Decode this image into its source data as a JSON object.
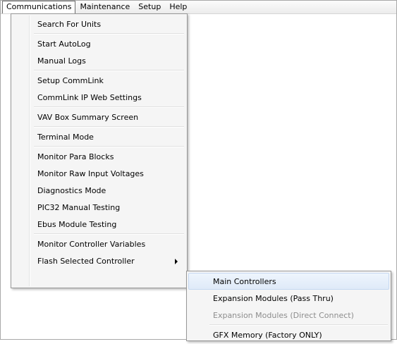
{
  "menubar": {
    "items": [
      {
        "label": "Communications"
      },
      {
        "label": "Maintenance"
      },
      {
        "label": "Setup"
      },
      {
        "label": "Help"
      }
    ]
  },
  "communications_menu": {
    "items": [
      {
        "label": "Search For Units"
      },
      {
        "label": "Start AutoLog"
      },
      {
        "label": "Manual Logs"
      },
      {
        "label": "Setup CommLink"
      },
      {
        "label": "CommLink IP Web Settings"
      },
      {
        "label": "VAV Box Summary Screen"
      },
      {
        "label": "Terminal Mode"
      },
      {
        "label": "Monitor Para Blocks"
      },
      {
        "label": "Monitor Raw Input Voltages"
      },
      {
        "label": "Diagnostics Mode"
      },
      {
        "label": "PIC32 Manual Testing"
      },
      {
        "label": "Ebus Module Testing"
      },
      {
        "label": "Monitor Controller Variables"
      },
      {
        "label": "Flash Selected Controller"
      }
    ]
  },
  "flash_submenu": {
    "items": [
      {
        "label": "Main Controllers"
      },
      {
        "label": "Expansion Modules (Pass Thru)"
      },
      {
        "label": "Expansion Modules (Direct Connect)"
      },
      {
        "label": "GFX Memory (Factory ONLY)"
      }
    ]
  }
}
